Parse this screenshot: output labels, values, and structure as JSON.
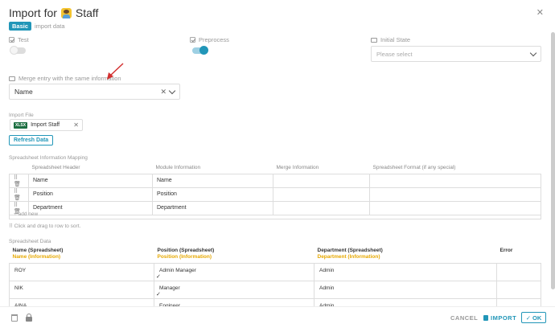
{
  "dialog": {
    "title": "Import for",
    "module": "Staff",
    "badge": "Basic",
    "subtitle": "import data"
  },
  "options": {
    "test_label": "Test",
    "test_on": false,
    "preprocess_label": "Preprocess",
    "preprocess_on": true,
    "initial_state_label": "Initial State",
    "initial_state_placeholder": "Please select"
  },
  "merge": {
    "label": "Merge entry with the same information",
    "value": "Name"
  },
  "import_file": {
    "label": "Import File",
    "badge": "XLSX",
    "file_name": "Import Staff",
    "refresh_label": "Refresh Data"
  },
  "mapping": {
    "label": "Spreadsheet Information Mapping",
    "columns": [
      "Spreadsheet Header",
      "Module Information",
      "Merge Information",
      "Spreadsheet Format (if any special)"
    ],
    "rows": [
      {
        "header": "Name",
        "module": "Name",
        "merge": "",
        "format": ""
      },
      {
        "header": "Position",
        "module": "Position",
        "merge": "",
        "format": ""
      },
      {
        "header": "Department",
        "module": "Department",
        "merge": "",
        "format": ""
      }
    ],
    "add_new": "+ add new",
    "drag_hint": "Click and drag to row to sort."
  },
  "spreadsheet": {
    "label": "Spreadsheet Data",
    "columns": [
      {
        "title": "Name (Spreadsheet)",
        "sub": "Name (Information)"
      },
      {
        "title": "Position (Spreadsheet)",
        "sub": "Position (Information)"
      },
      {
        "title": "Department (Spreadsheet)",
        "sub": "Department (Information)"
      },
      {
        "title": "Error",
        "sub": ""
      }
    ],
    "rows": [
      {
        "name": "ROY",
        "position": "Admin Manager",
        "department": "Admin",
        "error": ""
      },
      {
        "name": "NIK",
        "position": "Manager",
        "department": "Admin",
        "error": ""
      },
      {
        "name": "AINA",
        "position": "Engineer",
        "department": "Admin",
        "error": ""
      }
    ]
  },
  "footer": {
    "cancel": "CANCEL",
    "import": "IMPORT",
    "ok": "OK"
  },
  "colors": {
    "accent": "#2196b8",
    "highlight": "#e6a800",
    "arrow": "#d32f2f"
  }
}
